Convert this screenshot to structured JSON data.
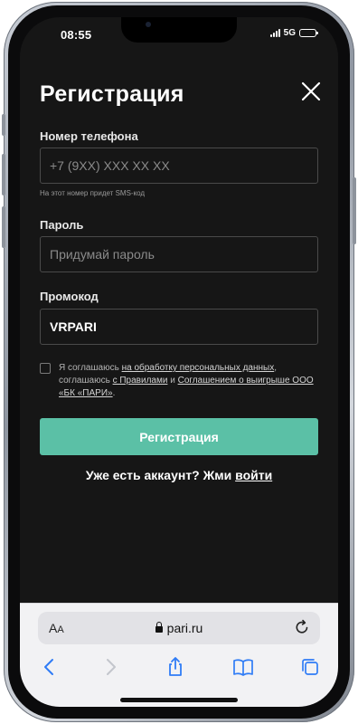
{
  "status_bar": {
    "time": "08:55",
    "network": "5G"
  },
  "page": {
    "title": "Регистрация"
  },
  "phone": {
    "label": "Номер телефона",
    "placeholder": "+7 (9XX) XXX XX XX",
    "hint": "На этот номер придет SMS-код"
  },
  "password": {
    "label": "Пароль",
    "placeholder": "Придумай пароль"
  },
  "promo": {
    "label": "Промокод",
    "value": "VRPARI"
  },
  "agreement": {
    "prefix": "Я соглашаюсь ",
    "link_data": "на обработку персональных данных",
    "middle": ", соглашаюсь ",
    "link_rules": "с Правилами",
    "and": " и ",
    "link_terms": "Соглашением о выигрыше ООО «БК «ПАРИ»",
    "end": "."
  },
  "register_button": "Регистрация",
  "login_prompt": {
    "text": "Уже есть аккаунт? Жми ",
    "link": "войти"
  },
  "browser": {
    "aa": "A",
    "aa_small": "A",
    "url": "pari.ru"
  },
  "colors": {
    "accent": "#5bc0a6",
    "background": "#161616",
    "safari_bar": "#f2f2f4",
    "safari_icons": "#2f7cf6"
  },
  "icons": [
    "close-icon",
    "lock-icon",
    "reload-icon",
    "back-icon",
    "forward-icon",
    "share-icon",
    "bookmarks-icon",
    "tabs-icon",
    "signal-icon",
    "battery-icon"
  ]
}
